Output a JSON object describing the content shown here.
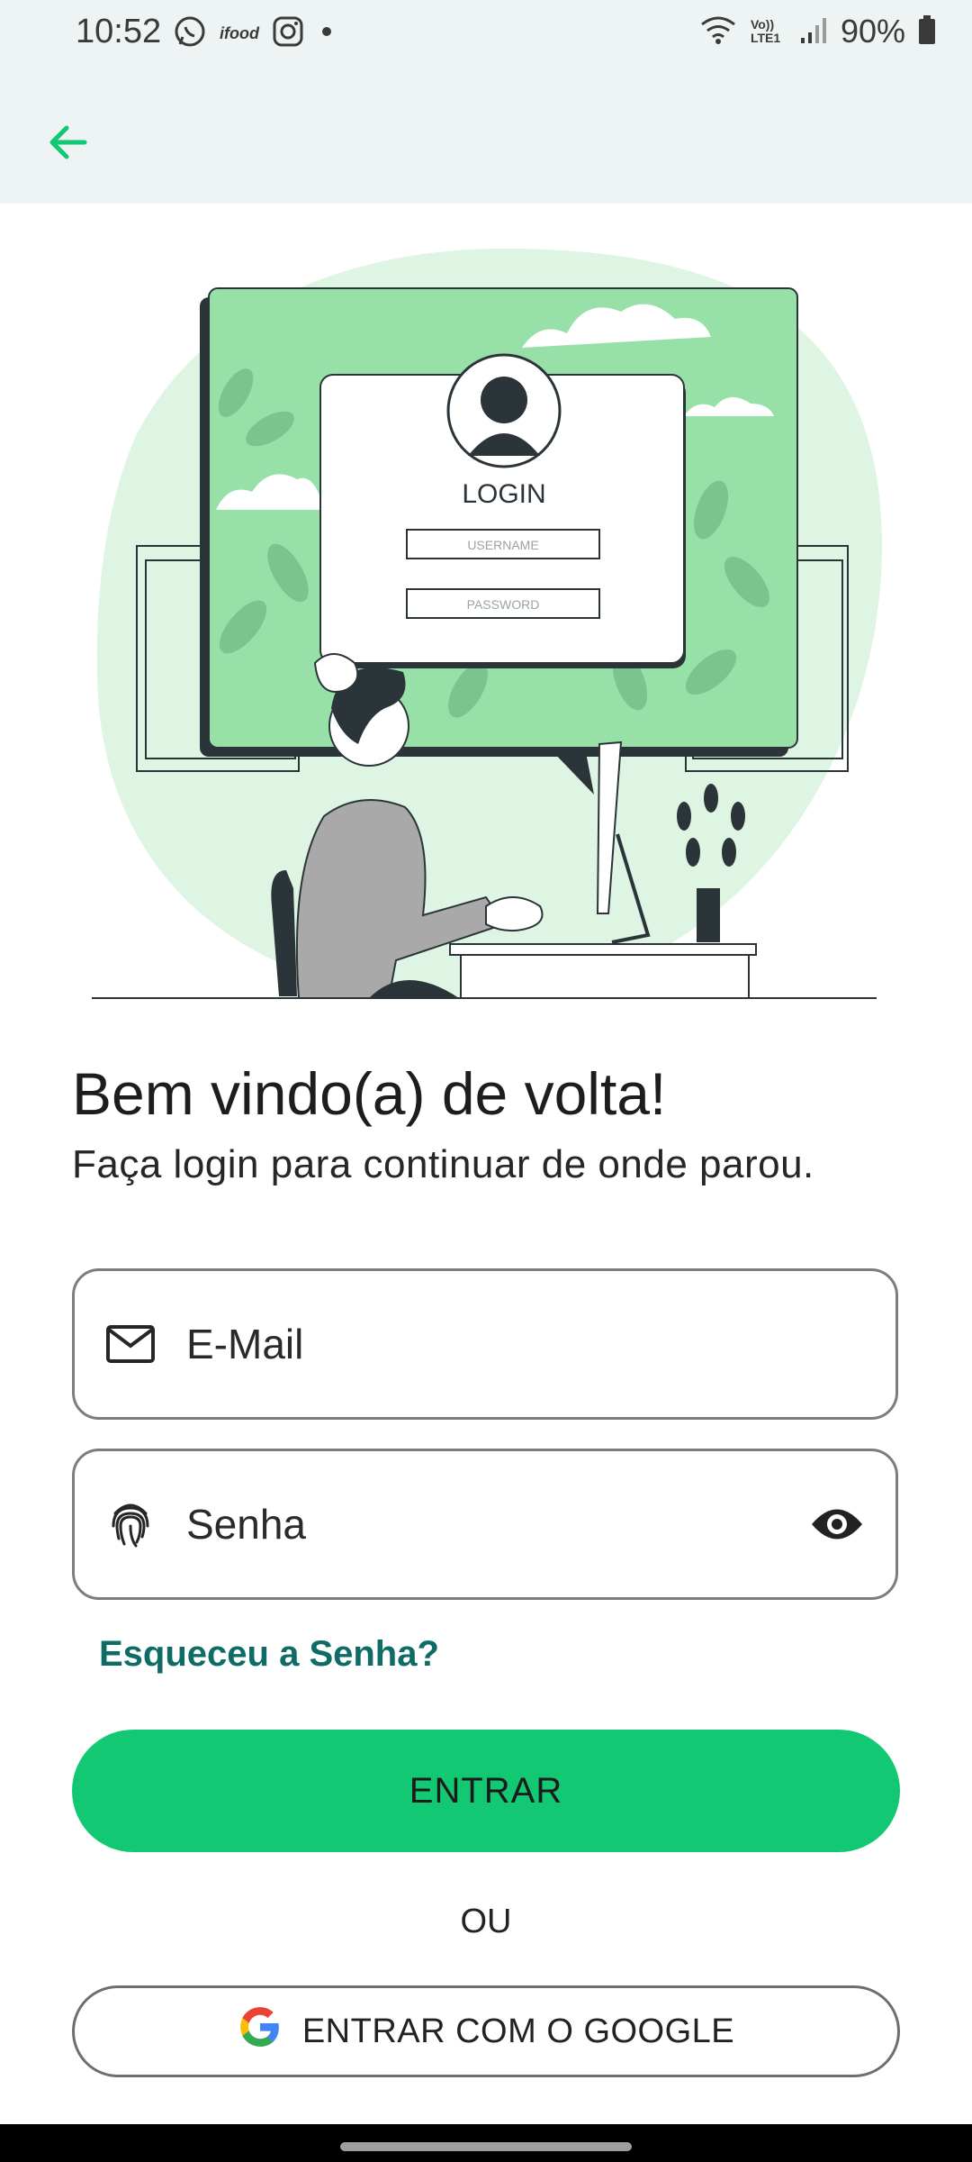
{
  "status": {
    "time": "10:52",
    "battery": "90%",
    "left_icons": [
      "whatsapp-icon",
      "ifood-icon",
      "instagram-icon",
      "dot-icon"
    ],
    "right_icons": [
      "wifi-icon",
      "volte-icon",
      "signal-icon",
      "battery-icon"
    ],
    "volte_text": "Vo)) LTE1",
    "ifood_text": "ifood"
  },
  "illustration": {
    "login_title": "LOGIN",
    "username_placeholder": "USERNAME",
    "password_placeholder": "PASSWORD"
  },
  "welcome": {
    "title": "Bem vindo(a) de volta!",
    "subtitle": "Faça login para continuar de onde parou."
  },
  "form": {
    "email_placeholder": "E-Mail",
    "email_value": "",
    "password_placeholder": "Senha",
    "password_value": "",
    "forgot_label": "Esqueceu a Senha?",
    "submit_label": "ENTRAR",
    "or_label": "OU",
    "google_label": "ENTRAR COM O GOOGLE"
  },
  "colors": {
    "accent": "#12c872",
    "link": "#0f6b66",
    "appbar_bg": "#eef3f4",
    "illustration_green": "#97e0a8"
  }
}
